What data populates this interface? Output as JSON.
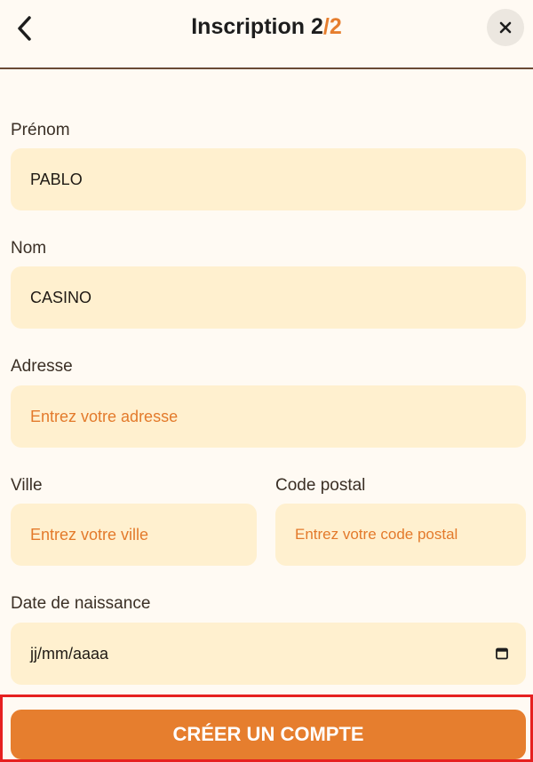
{
  "header": {
    "title": "Inscription",
    "step_current": "2",
    "step_sep": "/",
    "step_total": "2"
  },
  "form": {
    "prenom": {
      "label": "Prénom",
      "value": "PABLO"
    },
    "nom": {
      "label": "Nom",
      "value": "CASINO"
    },
    "adresse": {
      "label": "Adresse",
      "placeholder": "Entrez votre adresse"
    },
    "ville": {
      "label": "Ville",
      "placeholder": "Entrez votre ville"
    },
    "code_postal": {
      "label": "Code postal",
      "placeholder": "Entrez votre code postal"
    },
    "date_naissance": {
      "label": "Date de naissance",
      "placeholder": "jj/mm/aaaa"
    }
  },
  "actions": {
    "submit_label": "CRÉER UN COMPTE"
  },
  "icons": {
    "back": "chevron-left-icon",
    "close": "close-icon",
    "calendar": "calendar-icon"
  },
  "colors": {
    "accent": "#e67e2e",
    "field_bg": "#fff0cf",
    "page_bg": "#fffaf3",
    "highlight": "#e62020"
  }
}
